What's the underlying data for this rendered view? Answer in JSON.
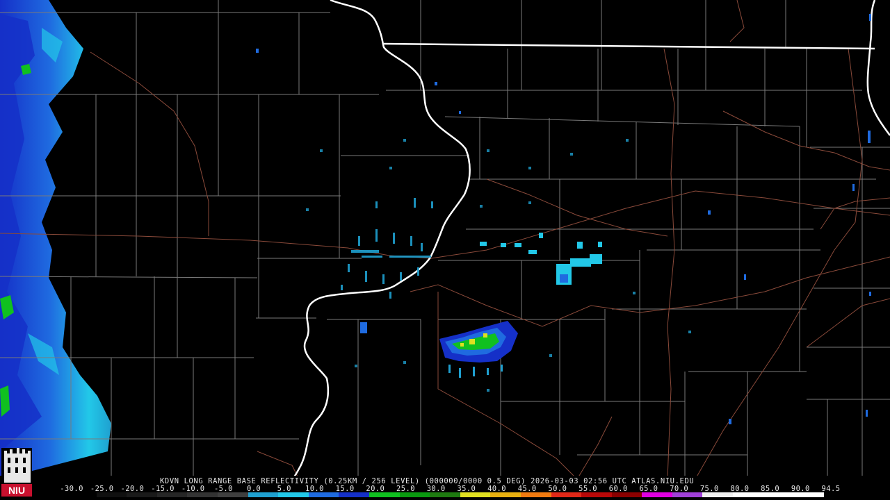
{
  "caption": "KDVN LONG RANGE BASE REFLECTIVITY (0.25KM / 256 LEVEL) (000000/0000 0.5 DEG) 2026-03-03 02:56 UTC  ATLAS.NIU.EDU",
  "scale": {
    "ticks": [
      "-30.0",
      "-25.0",
      "-20.0",
      "-15.0",
      "-10.0",
      "-5.0",
      "0.0",
      "5.0",
      "10.0",
      "15.0",
      "20.0",
      "25.0",
      "30.0",
      "35.0",
      "40.0",
      "45.0",
      "50.0",
      "55.0",
      "60.0",
      "65.0",
      "70.0",
      "75.0",
      "80.0",
      "85.0",
      "90.0",
      "94.5"
    ],
    "colors": [
      "#000000",
      "#101010",
      "#1a1a1a",
      "#262626",
      "#333333",
      "#3f3f3f",
      "#1fa0d0",
      "#22c8e8",
      "#1f6be0",
      "#1530c8",
      "#10c020",
      "#0a9a10",
      "#1e7a10",
      "#e0e020",
      "#e8b010",
      "#f07a10",
      "#e02818",
      "#b80808",
      "#8a0000",
      "#e000e0",
      "#a040d8",
      "#f0f0f0",
      "#ffffff",
      "#ffffff",
      "#ffffff"
    ]
  },
  "logo": {
    "text": "NIU",
    "color": "#c8102e"
  },
  "colors": {
    "state_border": "#ffffff",
    "county_line": "#7a7a7a",
    "road": "#8a4a3a",
    "background": "#000000"
  }
}
